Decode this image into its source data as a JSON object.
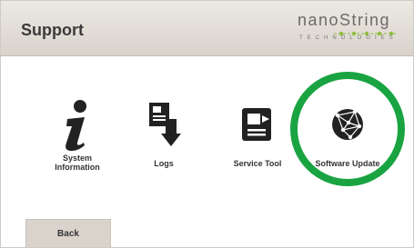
{
  "header": {
    "title": "Support",
    "logo_text": "nanoString",
    "logo_subtext": "TECHNOLOGIES"
  },
  "tiles": [
    {
      "label_line1": "System",
      "label_line2": "Information",
      "icon": "info-icon"
    },
    {
      "label": "Logs",
      "icon": "logs-icon"
    },
    {
      "label": "Service Tool",
      "icon": "service-tool-icon"
    },
    {
      "label": "Software Update",
      "icon": "globe-network-icon"
    }
  ],
  "footer": {
    "back_label": "Back"
  },
  "colors": {
    "header_bg": "#ddd7d0",
    "highlight_ring": "#19a441",
    "logo_dots": "#8dbf3f",
    "icon_dark": "#222222"
  }
}
